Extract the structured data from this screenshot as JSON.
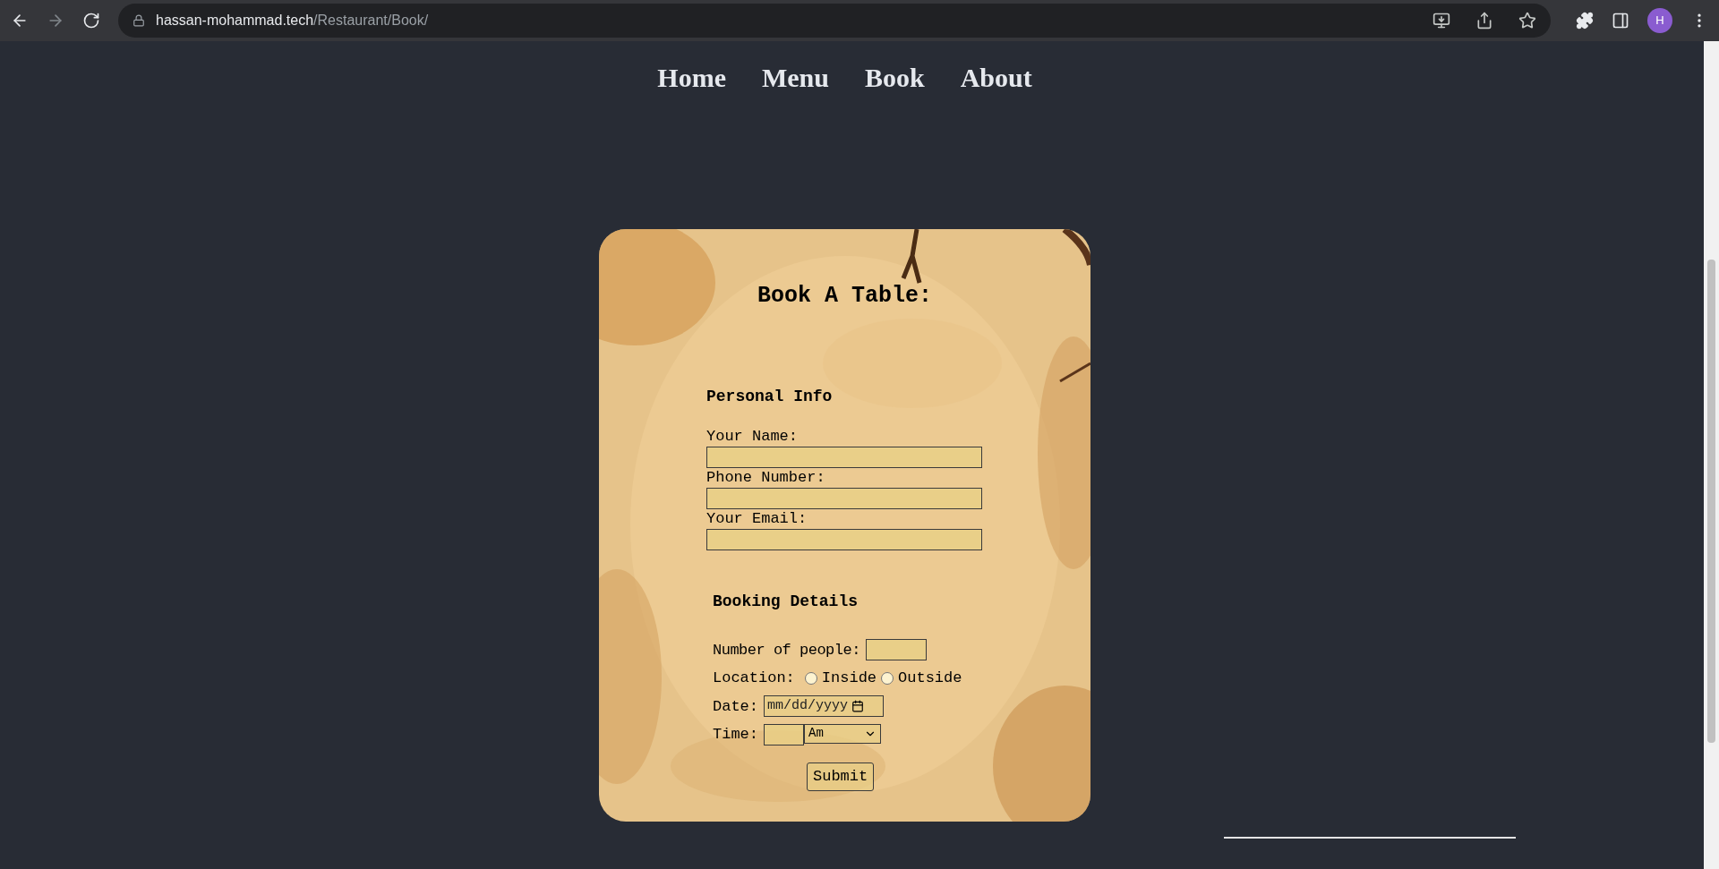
{
  "browser": {
    "url_host": "hassan-mohammad.tech",
    "url_path": "/Restaurant/Book/",
    "avatar": "H"
  },
  "nav": [
    {
      "label": "Home"
    },
    {
      "label": "Menu"
    },
    {
      "label": "Book"
    },
    {
      "label": "About"
    }
  ],
  "form": {
    "title": "Book A Table:",
    "personal": {
      "heading": "Personal Info",
      "fields": [
        {
          "label": "Your Name:"
        },
        {
          "label": "Phone Number:"
        },
        {
          "label": "Your Email:"
        }
      ]
    },
    "booking": {
      "heading": "Booking Details",
      "people_label": "Number of people:",
      "location": {
        "label": "Location:",
        "options": [
          {
            "label": "Inside",
            "selected": false
          },
          {
            "label": "Outside",
            "selected": false
          }
        ]
      },
      "date": {
        "label": "Date:",
        "placeholder": "mm/dd/yyyy"
      },
      "time": {
        "label": "Time:",
        "period": "Am"
      }
    },
    "submit": "Submit"
  }
}
